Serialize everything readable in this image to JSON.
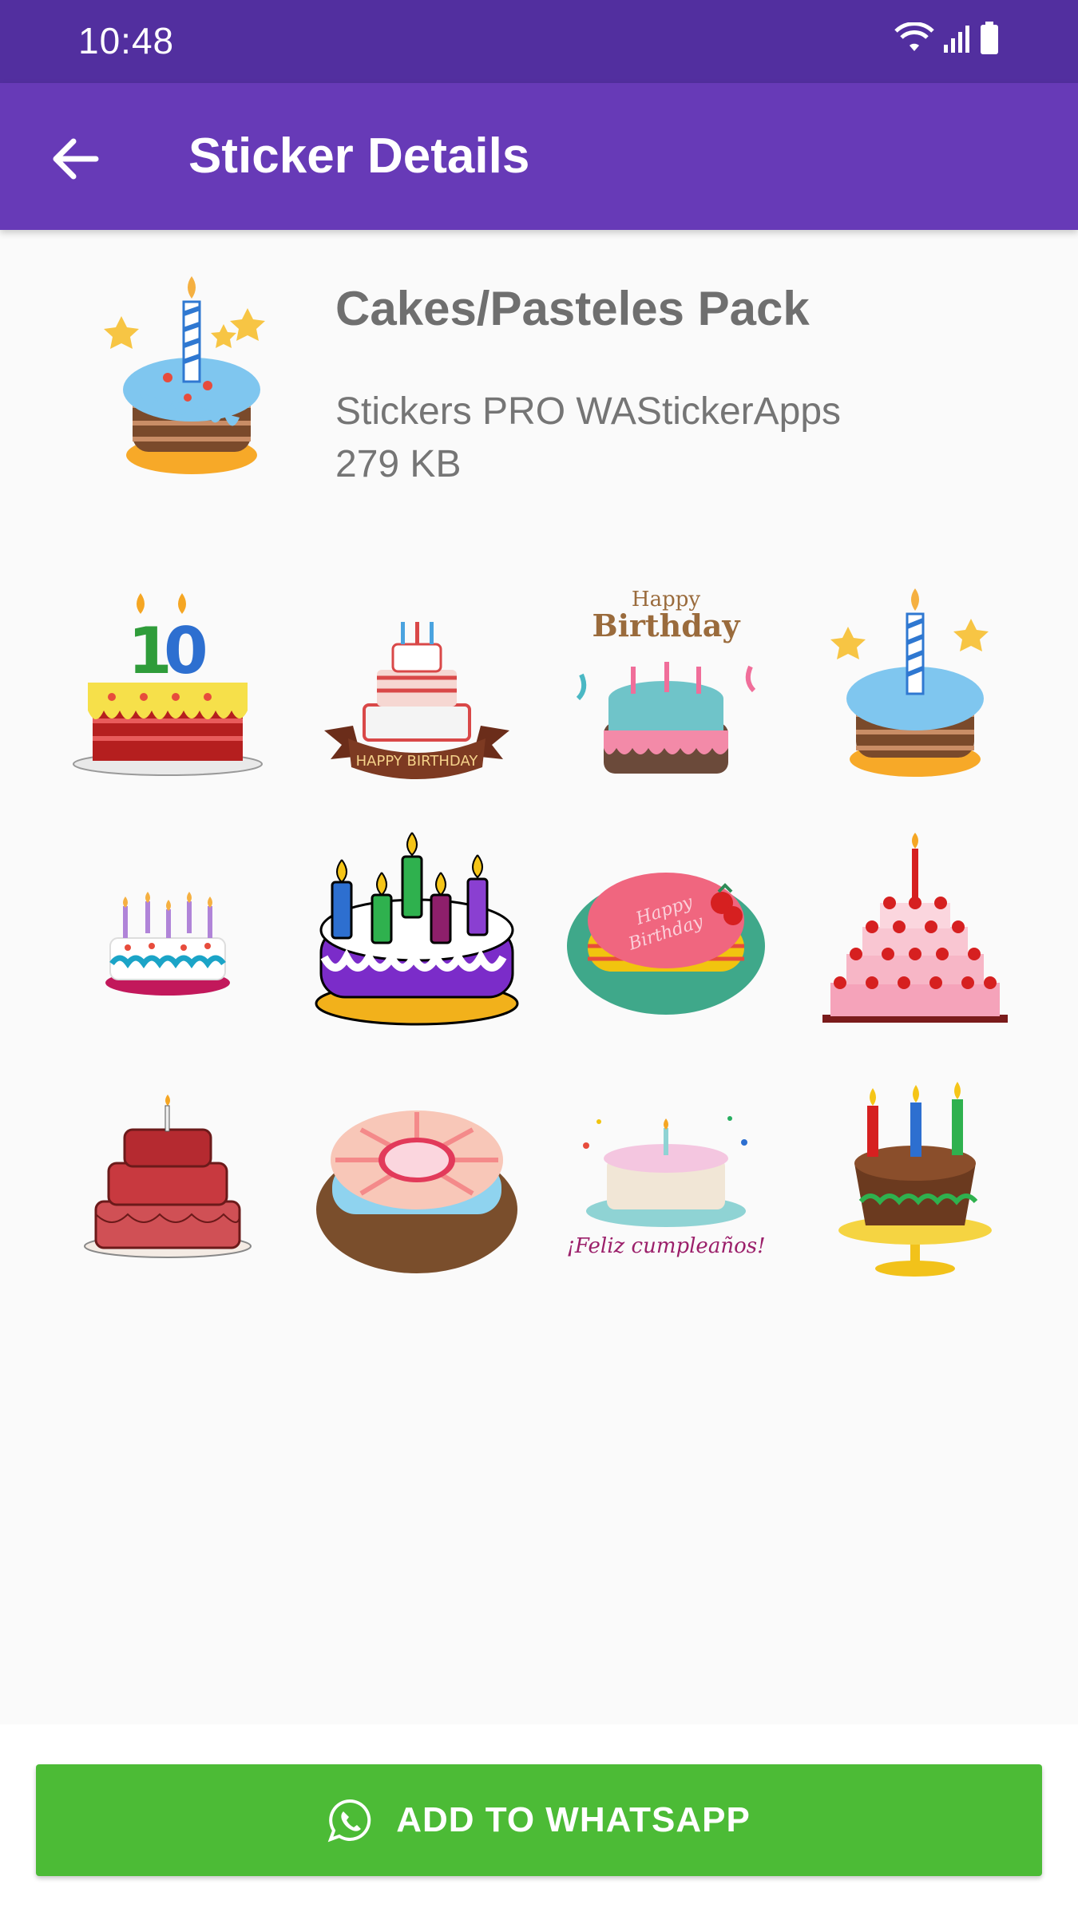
{
  "status_bar": {
    "time": "10:48"
  },
  "app_bar": {
    "title": "Sticker Details"
  },
  "pack": {
    "name": "Cakes/Pasteles Pack",
    "publisher": "Stickers PRO WAStickerApps",
    "size": "279 KB"
  },
  "stickers": [
    {
      "id": "cake-10",
      "text": "10"
    },
    {
      "id": "cake-happy-birthday-ribbon",
      "text": "HAPPY BIRTHDAY"
    },
    {
      "id": "cake-happy-birthday-pink",
      "text": "Happy Birthday"
    },
    {
      "id": "cake-blue-stars",
      "text": ""
    },
    {
      "id": "cake-small-candles",
      "text": ""
    },
    {
      "id": "cake-purple-candles",
      "text": ""
    },
    {
      "id": "cake-pink-strawberry",
      "text": "Happy Birthday"
    },
    {
      "id": "cake-tiered-strawberries",
      "text": ""
    },
    {
      "id": "cake-red-tiered",
      "text": ""
    },
    {
      "id": "cake-blue-swirl",
      "text": ""
    },
    {
      "id": "cake-feliz-cumpleanos",
      "text": "¡Feliz cumpleaños!"
    },
    {
      "id": "cake-chocolate-stand",
      "text": ""
    }
  ],
  "add_button": {
    "label": "ADD TO WHATSAPP"
  },
  "colors": {
    "status_bar": "#522f9f",
    "app_bar": "#673ab7",
    "button": "#4cbb36",
    "background": "#fafafa"
  }
}
